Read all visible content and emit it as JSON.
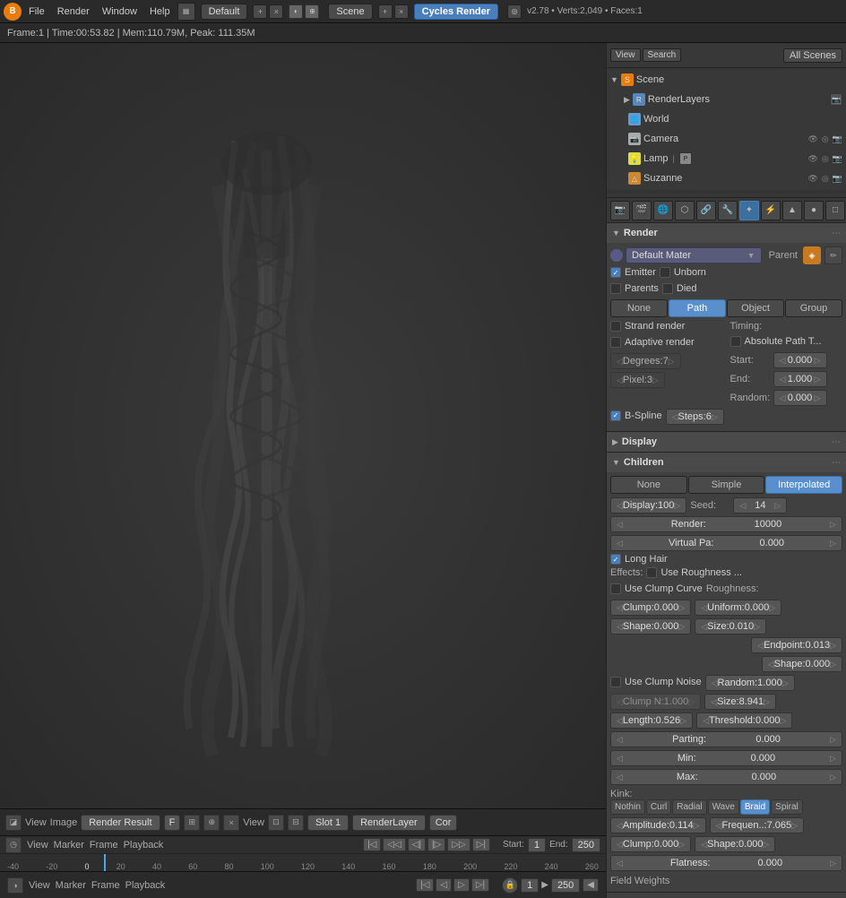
{
  "app": {
    "title": "Blender",
    "version": "v2.78 • Verts:2,049 • Faces:1",
    "workspace": "Default",
    "scene": "Scene",
    "render_engine": "Cycles Render"
  },
  "info_bar": {
    "text": "Frame:1 | Time:00:53.82 | Mem:110.79M, Peak: 111.35M"
  },
  "outliner": {
    "toolbar": {
      "view_label": "View",
      "search_label": "Search",
      "all_scenes_label": "All Scenes"
    },
    "tree": [
      {
        "id": "scene",
        "indent": 0,
        "icon": "S",
        "icon_class": "icon-scene",
        "label": "Scene"
      },
      {
        "id": "renderlayers",
        "indent": 1,
        "icon": "R",
        "icon_class": "icon-renderlayer",
        "label": "RenderLayers"
      },
      {
        "id": "world",
        "indent": 1,
        "icon": "W",
        "icon_class": "icon-world",
        "label": "World"
      },
      {
        "id": "camera",
        "indent": 1,
        "icon": "C",
        "icon_class": "icon-camera",
        "label": "Camera"
      },
      {
        "id": "lamp",
        "indent": 1,
        "icon": "L",
        "icon_class": "icon-lamp",
        "label": "Lamp"
      },
      {
        "id": "suzanne",
        "indent": 1,
        "icon": "M",
        "icon_class": "icon-mesh",
        "label": "Suzanne"
      }
    ]
  },
  "properties": {
    "section_render": {
      "title": "Render",
      "label_render": "Render",
      "material_label": "Default Mater",
      "parent_label": "Parent",
      "emitter_label": "Emitter",
      "parents_label": "Parents",
      "unborn_label": "Unborn",
      "died_label": "Died"
    },
    "tabs_path": {
      "none": "None",
      "path": "Path",
      "object": "Object",
      "group": "Group"
    },
    "path_settings": {
      "strand_render_label": "Strand render",
      "adaptive_render_label": "Adaptive render",
      "degrees_label": "Degrees:",
      "degrees_value": "7",
      "pixel_label": "Pixel:",
      "pixel_value": "3",
      "b_spline_label": "B-Spline",
      "steps_label": "Steps:",
      "steps_value": "6"
    },
    "timing": {
      "label": "Timing:",
      "absolute_path_label": "Absolute Path T...",
      "start_label": "Start:",
      "start_value": "0.000",
      "end_label": "End:",
      "end_value": "1.000",
      "random_label": "Random:",
      "random_value": "0.000"
    },
    "display": {
      "title": "Display"
    },
    "children": {
      "title": "Children",
      "tabs": {
        "none": "None",
        "simple": "Simple",
        "interpolated": "Interpolated"
      },
      "display_label": "Display:",
      "display_value": "100",
      "render_label": "Render:",
      "render_value": "10000",
      "seed_label": "Seed:",
      "seed_value": "14",
      "virtual_pa_label": "Virtual Pa:",
      "virtual_pa_value": "0.000",
      "long_hair_label": "Long Hair",
      "effects_label": "Effects:",
      "use_roughness_label": "Use Roughness ...",
      "use_clump_curve_label": "Use Clump Curve",
      "clump_label": "Clump:",
      "clump_value": "0.000",
      "shape_label": "Shape:",
      "shape_value": "0.000",
      "roughness_label": "Roughness:",
      "uniform_label": "Uniform:",
      "uniform_value": "0.000",
      "size_label": "Size:",
      "size_value": "0.010",
      "endpoint_label": "Endpoint:",
      "endpoint_value": "0.013",
      "shape2_label": "Shape:",
      "shape2_value": "0.000",
      "use_clump_noise_label": "Use Clump Noise",
      "clump_n_label": "Clump N:",
      "clump_n_value": "1.000",
      "random_label": "Random:",
      "random_value": "1.000",
      "size2_label": "Size:",
      "size2_value": "8.941",
      "threshold_label": "Threshold:",
      "threshold_value": "0.000",
      "length_label": "Length:",
      "length_value": "0.526",
      "threshold2_label": "Threshold:",
      "threshold2_value": "0.000",
      "parting_label": "Parting:",
      "parting_value": "0.000",
      "min_label": "Min:",
      "min_value": "0.000",
      "max_label": "Max:",
      "max_value": "0.000",
      "kink_label": "Kink:",
      "kink_tabs": [
        "Nothin",
        "Curl",
        "Radial",
        "Wave",
        "Braid",
        "Spiral"
      ],
      "kink_active": "Braid",
      "amplitude_label": "Amplitude:",
      "amplitude_value": "0.114",
      "frequen_label": "Frequen..:",
      "frequen_value": "7.065",
      "clump2_label": "Clump:",
      "clump2_value": "0.000",
      "shape3_label": "Shape:",
      "shape3_value": "0.000",
      "flatness_label": "Flatness:",
      "flatness_value": "0.000"
    }
  },
  "viewport_bottom": {
    "view_label": "View",
    "image_label": "Image",
    "render_result_label": "Render Result",
    "f_label": "F",
    "view2_label": "View",
    "slot_label": "Slot 1",
    "render_layer_label": "RenderLayer",
    "cor_label": "Cor"
  },
  "timeline": {
    "view_label": "View",
    "marker_label": "Marker",
    "frame_label": "Frame",
    "playback_label": "Playback",
    "start_label": "Start:",
    "start_value": "1",
    "end_label": "End:",
    "end_value": "250",
    "frame_markers": [
      "-40",
      "-20",
      "0",
      "20",
      "40",
      "60",
      "80",
      "100",
      "120",
      "140",
      "160",
      "180",
      "200",
      "220",
      "240",
      "260"
    ]
  }
}
